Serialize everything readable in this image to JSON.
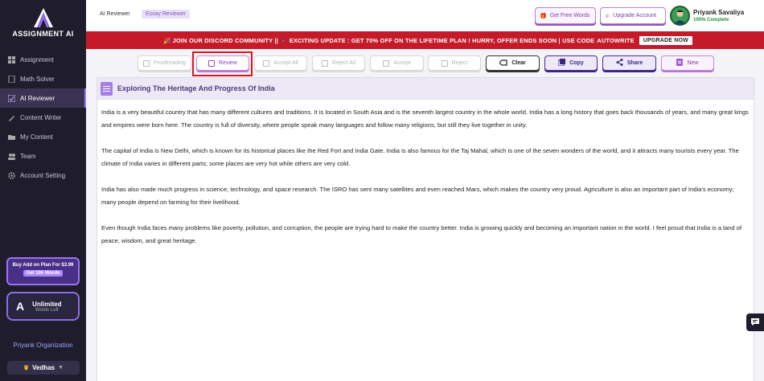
{
  "app": {
    "brand": "ASSIGNMENT AI"
  },
  "sidebar": {
    "items": [
      {
        "label": "Assignment",
        "icon": "grid-icon"
      },
      {
        "label": "Math Solver",
        "icon": "calculator-icon"
      },
      {
        "label": "AI Reviewer",
        "icon": "reviewer-icon",
        "active": true
      },
      {
        "label": "Content Writer",
        "icon": "pen-icon"
      },
      {
        "label": "My Content",
        "icon": "folder-icon"
      },
      {
        "label": "Team",
        "icon": "team-icon"
      },
      {
        "label": "Account Setting",
        "icon": "gear-icon"
      }
    ],
    "addon": {
      "title": "Buy Add on Plan For $3.99",
      "badge": "Get 10k Words"
    },
    "plan": {
      "title": "Unlimited",
      "subtitle": "Words Left"
    },
    "organization": "Priyank Organization",
    "workspace": "Vedhas"
  },
  "header": {
    "breadcrumb_parent": "AI Reviewer",
    "breadcrumb_current": "Essay Reviewer",
    "free_words_label": "Get Free Words",
    "upgrade_label": "Upgrade Account",
    "user_name": "Priyank Savaliya",
    "user_status": "100% Complete"
  },
  "banner": {
    "text": "🎉 JOIN OUR DISCORD COMMUNITY || 🔹 EXCITING UPDATE : GET 70% OFF ON THE LIFETIME PLAN ! HURRY, OFFER ENDS SOON | USE CODE",
    "code": "AUTOWRITE",
    "button": "UPGRADE NOW"
  },
  "toolbar": {
    "proofreading": "Proofreading",
    "review": "Review",
    "accept_all": "Accept All",
    "reject_all": "Reject All",
    "accept": "Accept",
    "reject": "Reject",
    "clear": "Clear",
    "copy": "Copy",
    "share": "Share",
    "new": "New"
  },
  "document": {
    "title": "Exploring The Heritage And Progress Of India",
    "paragraphs": [
      "India is a very beautiful country that has many different cultures and traditions. It is located in South Asia and is the seventh largest country in the whole world. India has a long history that goes back thousands of years, and many great kings and empires were born here. The country is full of diversity, where people speak many languages and follow many religions, but still they live together in unity.",
      "The capital of India is New Delhi, which is known for its historical places like the Red Fort and India Gate. India is also famous for the Taj Mahal, which is one of the seven wonders of the world, and it attracts many tourists every year. The climate of India varies in different parts; some places are very hot while others are very cold.",
      "India has also made much progress in science, technology, and space research. The ISRO has sent many satellites and even reached Mars, which makes the country very proud. Agriculture is also an important part of India's economy; many people depend on farming for their livelihood.",
      "Even though India faces many problems like poverty, pollution, and corruption, the people are trying hard to make the country better. India is growing quickly and becoming an important nation in the world. I feel proud that India is a land of peace, wisdom, and great heritage."
    ]
  }
}
